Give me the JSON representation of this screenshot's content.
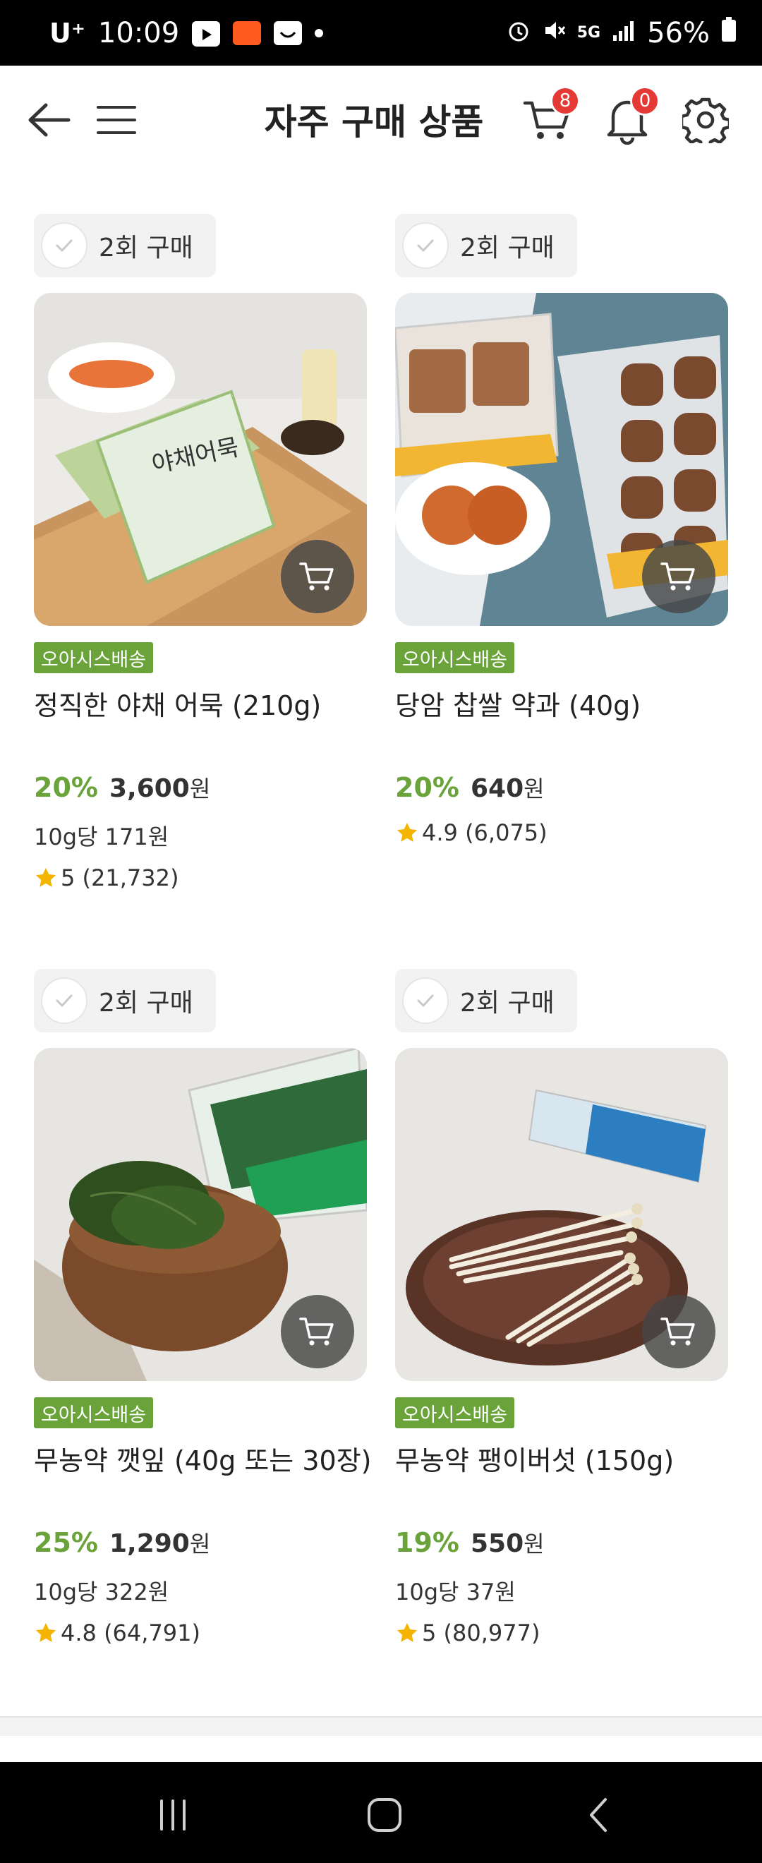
{
  "status_bar": {
    "carrier": "U⁺",
    "time": "10:09",
    "battery": "56%"
  },
  "header": {
    "title": "자주 구매 상품",
    "cart_count": "8",
    "notification_count": "0"
  },
  "products": [
    {
      "purchase_label": "2회 구매",
      "delivery": "오아시스배송",
      "name": "정직한 야채 어묵 (210g)",
      "discount": "20%",
      "price": "3,600",
      "currency": "원",
      "unit_price": "10g당 171원",
      "rating": "5 (21,732)"
    },
    {
      "purchase_label": "2회 구매",
      "delivery": "오아시스배송",
      "name": "당암 찹쌀 약과 (40g)",
      "discount": "20%",
      "price": "640",
      "currency": "원",
      "unit_price": "",
      "rating": "4.9 (6,075)"
    },
    {
      "purchase_label": "2회 구매",
      "delivery": "오아시스배송",
      "name": "무농약 깻잎 (40g 또는 30장)",
      "discount": "25%",
      "price": "1,290",
      "currency": "원",
      "unit_price": "10g당 322원",
      "rating": "4.8 (64,791)"
    },
    {
      "purchase_label": "2회 구매",
      "delivery": "오아시스배송",
      "name": "무농약 팽이버섯 (150g)",
      "discount": "19%",
      "price": "550",
      "currency": "원",
      "unit_price": "10g당 37원",
      "rating": "5 (80,977)"
    }
  ],
  "colors": {
    "accent_green": "#6aa33a",
    "badge_red": "#e53935",
    "star": "#f5b400"
  },
  "icons": [
    "back-arrow-icon",
    "menu-icon",
    "cart-icon",
    "bell-icon",
    "gear-icon",
    "check-icon",
    "star-icon"
  ]
}
